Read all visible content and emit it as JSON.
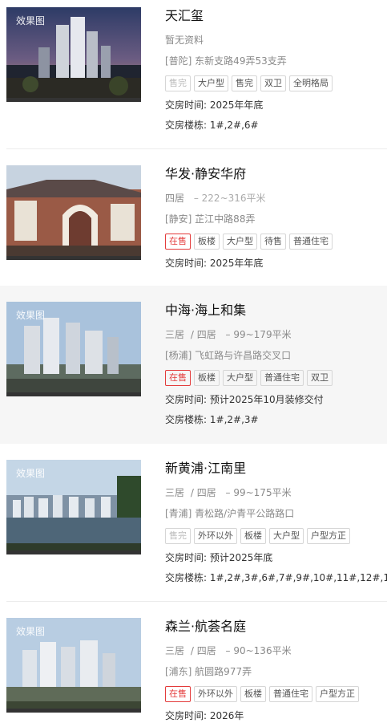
{
  "watermark": "效果图",
  "listings": [
    {
      "name": "天汇玺",
      "layout": "暂无资料",
      "address": "[普陀] 东新支路49弄53支弄",
      "tags": [
        "售完",
        "大户型",
        "售完",
        "双卫",
        "全明格局"
      ],
      "delivery_label": "交房时间:",
      "delivery_value": "2025年年底",
      "buildings_label": "交房楼栋:",
      "buildings_value": "1#,2#,6#"
    },
    {
      "name": "华发·静安华府",
      "layout_rooms": [
        "四居"
      ],
      "area": "– 222~316平米",
      "address": "[静安] 芷江中路88弄",
      "tags": [
        "在售",
        "板楼",
        "大户型",
        "待售",
        "普通住宅"
      ],
      "delivery_label": "交房时间:",
      "delivery_value": "2025年年底"
    },
    {
      "name": "中海·海上和集",
      "layout_rooms": [
        "三居",
        "/ 四居"
      ],
      "area": "– 99~179平米",
      "address": "[杨浦] 飞虹路与许昌路交叉口",
      "tags": [
        "在售",
        "板楼",
        "大户型",
        "普通住宅",
        "双卫"
      ],
      "delivery_label": "交房时间:",
      "delivery_value": "预计2025年10月装修交付",
      "buildings_label": "交房楼栋:",
      "buildings_value": "1#,2#,3#"
    },
    {
      "name": "新黄浦·江南里",
      "layout_rooms": [
        "三居",
        "/ 四居"
      ],
      "area": "– 99~175平米",
      "address": "[青浦] 青松路/沪青平公路路口",
      "tags": [
        "售完",
        "外环以外",
        "板楼",
        "大户型",
        "户型方正"
      ],
      "delivery_label": "交房时间:",
      "delivery_value": "预计2025年底",
      "buildings_label": "交房楼栋:",
      "buildings_value": "1#,2#,3#,6#,7#,9#,10#,11#,12#,13#,14#,1"
    },
    {
      "name": "森兰·航荟名庭",
      "layout_rooms": [
        "三居",
        "/ 四居"
      ],
      "area": "– 90~136平米",
      "address": "[浦东] 航圆路977弄",
      "tags": [
        "在售",
        "外环以外",
        "板楼",
        "普通住宅",
        "户型方正"
      ],
      "delivery_label": "交房时间:",
      "delivery_value": "2026年"
    }
  ],
  "colors": {
    "on_sale": "#e33b3b",
    "sold_out": "#bbbbbb",
    "title": "#111111",
    "muted": "#8a8a8a"
  }
}
